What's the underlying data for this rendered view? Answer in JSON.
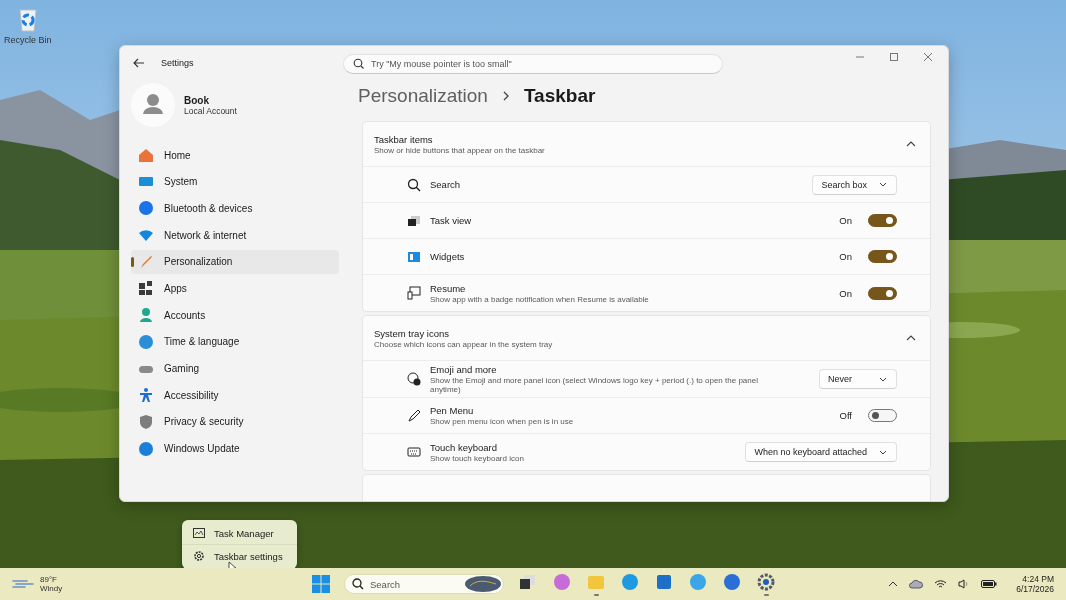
{
  "desktop": {
    "icons": [
      {
        "label": "Recycle Bin"
      }
    ]
  },
  "window": {
    "title": "Settings",
    "search": {
      "placeholder": "Try \"My mouse pointer is too small\""
    },
    "account": {
      "name": "Book",
      "type": "Local Account"
    },
    "nav": [
      {
        "label": "Home",
        "selected": false
      },
      {
        "label": "System",
        "selected": false
      },
      {
        "label": "Bluetooth & devices",
        "selected": false
      },
      {
        "label": "Network & internet",
        "selected": false
      },
      {
        "label": "Personalization",
        "selected": true
      },
      {
        "label": "Apps",
        "selected": false
      },
      {
        "label": "Accounts",
        "selected": false
      },
      {
        "label": "Time & language",
        "selected": false
      },
      {
        "label": "Gaming",
        "selected": false
      },
      {
        "label": "Accessibility",
        "selected": false
      },
      {
        "label": "Privacy & security",
        "selected": false
      },
      {
        "label": "Windows Update",
        "selected": false
      }
    ],
    "breadcrumb": {
      "parent": "Personalization",
      "current": "Taskbar"
    },
    "sections": [
      {
        "title": "Taskbar items",
        "subtitle": "Show or hide buttons that appear on the taskbar",
        "expanded": true,
        "items": [
          {
            "kind": "dropdown",
            "label": "Search",
            "value": "Search box"
          },
          {
            "kind": "toggle",
            "label": "Task view",
            "state_label": "On",
            "on": true
          },
          {
            "kind": "toggle",
            "label": "Widgets",
            "state_label": "On",
            "on": true
          },
          {
            "kind": "toggle",
            "label": "Resume",
            "description": "Show app with a badge notification when Resume is available",
            "state_label": "On",
            "on": true
          }
        ]
      },
      {
        "title": "System tray icons",
        "subtitle": "Choose which icons can appear in the system tray",
        "expanded": true,
        "items": [
          {
            "kind": "dropdown",
            "label": "Emoji and more",
            "description": "Show the Emoji and more panel icon (select Windows logo key + period (.) to open the panel anytime)",
            "value": "Never"
          },
          {
            "kind": "toggle",
            "label": "Pen Menu",
            "description": "Show pen menu icon when pen is in use",
            "state_label": "Off",
            "on": false
          },
          {
            "kind": "dropdown",
            "label": "Touch keyboard",
            "description": "Show touch keyboard icon",
            "value": "When no keyboard attached"
          }
        ]
      }
    ]
  },
  "context_menu": {
    "items": [
      {
        "label": "Task Manager"
      },
      {
        "label": "Taskbar settings"
      }
    ]
  },
  "taskbar": {
    "weather": {
      "temperature": "89°F",
      "condition": "Windy"
    },
    "search": {
      "placeholder": "Search"
    },
    "apps": [
      {
        "running": false
      },
      {
        "running": false
      },
      {
        "running": true
      },
      {
        "running": false
      },
      {
        "running": false
      },
      {
        "running": false
      },
      {
        "running": false
      },
      {
        "running": true
      }
    ],
    "clock": {
      "time": "4:24 PM",
      "date": "6/17/2026"
    }
  }
}
